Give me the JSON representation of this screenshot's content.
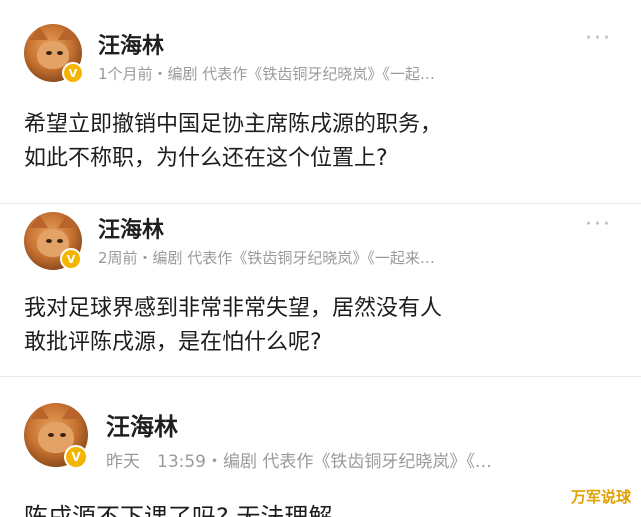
{
  "posts": [
    {
      "author": "汪海林",
      "meta": "1个月前・编剧 代表作《铁齿铜牙纪晓岚》《一起…",
      "content": "希望立即撤销中国足协主席陈戌源的职务，如此不称职，为什么还在这个位置上?",
      "more_label": "···",
      "badge": "V"
    },
    {
      "author": "汪海林",
      "meta": "2周前・编剧 代表作《铁齿铜牙纪晓岚》《一起来…",
      "content": "我对足球界感到非常非常失望，居然没有人敢批评陈戌源，是在怕什么呢?",
      "more_label": "···",
      "badge": "V"
    },
    {
      "author": "汪海林",
      "meta": "昨天　13:59・编剧 代表作《铁齿铜牙纪晓岚》《…",
      "content": "陈戌源不下课了吗? 无法理解",
      "badge": "V"
    }
  ],
  "watermark": "万军说球",
  "colors": {
    "badge": "#f5b400",
    "meta_text": "#9a9a9a",
    "watermark": "#e0a000"
  }
}
